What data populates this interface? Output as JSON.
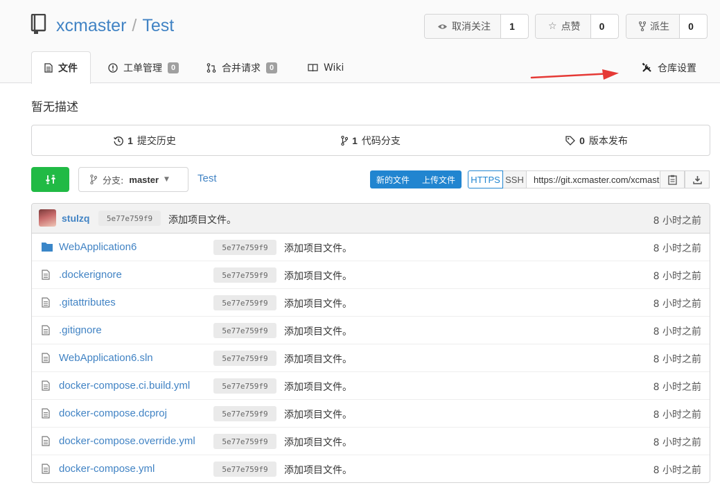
{
  "repo": {
    "owner": "xcmaster",
    "separator": "/",
    "name": "Test",
    "description": "暂无描述"
  },
  "actions": {
    "watch": {
      "label": "取消关注",
      "count": "1",
      "icon": "eye-icon"
    },
    "star": {
      "label": "点赞",
      "count": "0",
      "icon": "star-icon"
    },
    "fork": {
      "label": "派生",
      "count": "0",
      "icon": "fork-icon"
    }
  },
  "tabs": [
    {
      "label": "文件",
      "icon": "file-text-icon"
    },
    {
      "label": "工单管理",
      "count": "0",
      "icon": "issue-icon"
    },
    {
      "label": "合并请求",
      "count": "0",
      "icon": "pull-request-icon"
    },
    {
      "label": "Wiki",
      "icon": "book-icon"
    }
  ],
  "settings": {
    "label": "仓库设置",
    "icon": "tools-icon"
  },
  "annotation": {
    "arrow_color": "#e53935"
  },
  "stats": [
    {
      "count": "1",
      "label": "提交历史",
      "icon": "history-icon"
    },
    {
      "count": "1",
      "label": "代码分支",
      "icon": "branch-icon"
    },
    {
      "count": "0",
      "label": "版本发布",
      "icon": "tag-icon"
    }
  ],
  "toolbar": {
    "branch_prefix": "分支:",
    "branch_name": "master",
    "breadcrumb": "Test",
    "new_file": "新的文件",
    "upload_file": "上传文件",
    "https": "HTTPS",
    "ssh": "SSH",
    "clone_url": "https://git.xcmaster.com/xcmaster/Test.git"
  },
  "latest_commit": {
    "author": "stulzq",
    "sha": "5e77e759f9",
    "message": "添加项目文件。",
    "time": "8 小时之前"
  },
  "files": [
    {
      "name": "WebApplication6",
      "type": "folder",
      "sha": "5e77e759f9",
      "message": "添加项目文件。",
      "time": "8 小时之前"
    },
    {
      "name": ".dockerignore",
      "type": "file",
      "sha": "5e77e759f9",
      "message": "添加项目文件。",
      "time": "8 小时之前"
    },
    {
      "name": ".gitattributes",
      "type": "file",
      "sha": "5e77e759f9",
      "message": "添加项目文件。",
      "time": "8 小时之前"
    },
    {
      "name": ".gitignore",
      "type": "file",
      "sha": "5e77e759f9",
      "message": "添加项目文件。",
      "time": "8 小时之前"
    },
    {
      "name": "WebApplication6.sln",
      "type": "file",
      "sha": "5e77e759f9",
      "message": "添加项目文件。",
      "time": "8 小时之前"
    },
    {
      "name": "docker-compose.ci.build.yml",
      "type": "file",
      "sha": "5e77e759f9",
      "message": "添加项目文件。",
      "time": "8 小时之前"
    },
    {
      "name": "docker-compose.dcproj",
      "type": "file",
      "sha": "5e77e759f9",
      "message": "添加项目文件。",
      "time": "8 小时之前"
    },
    {
      "name": "docker-compose.override.yml",
      "type": "file",
      "sha": "5e77e759f9",
      "message": "添加项目文件。",
      "time": "8 小时之前"
    },
    {
      "name": "docker-compose.yml",
      "type": "file",
      "sha": "5e77e759f9",
      "message": "添加项目文件。",
      "time": "8 小时之前"
    }
  ]
}
